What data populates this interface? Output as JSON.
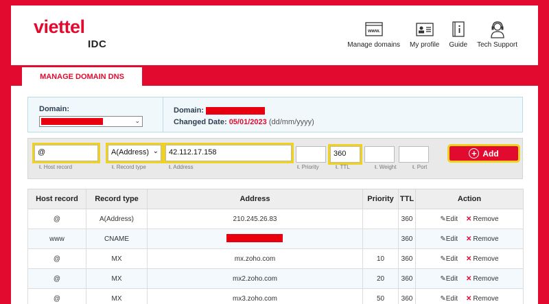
{
  "brand": {
    "name": "viettel",
    "sub": "IDC"
  },
  "nav": [
    {
      "label": "Manage domains",
      "icon": "www-icon",
      "glyph": "www."
    },
    {
      "label": "My profile",
      "icon": "profile-card-icon"
    },
    {
      "label": "Guide",
      "icon": "guide-book-icon"
    },
    {
      "label": "Tech Support",
      "icon": "headset-icon"
    }
  ],
  "tab": {
    "label": "MANAGE DOMAIN DNS"
  },
  "domain": {
    "label": "Domain:",
    "right_label": "Domain:",
    "changed_label": "Changed Date:",
    "changed_date": "05/01/2023",
    "date_format": "(dd/mm/yyyy)"
  },
  "form": {
    "host": {
      "value": "@",
      "label": "Host record"
    },
    "type": {
      "value": "A(Address)",
      "label": "Record type"
    },
    "address": {
      "value": "42.112.17.158",
      "label": "Address"
    },
    "priority": {
      "value": "",
      "label": "Priority"
    },
    "ttl": {
      "value": "360",
      "label": "TTL"
    },
    "weight": {
      "value": "",
      "label": "Weight"
    },
    "port": {
      "value": "",
      "label": "Port"
    },
    "label_prefix": "ŧ.",
    "add_label": "Add"
  },
  "table": {
    "headers": [
      "Host record",
      "Record type",
      "Address",
      "Priority",
      "TTL",
      "Action"
    ],
    "edit_label": "Edit",
    "remove_label": "Remove",
    "rows": [
      {
        "host": "@",
        "type": "A(Address)",
        "address": "210.245.26.83",
        "priority": "",
        "ttl": "360"
      },
      {
        "host": "www",
        "type": "CNAME",
        "address": "",
        "priority": "",
        "ttl": "360"
      },
      {
        "host": "@",
        "type": "MX",
        "address": "mx.zoho.com",
        "priority": "10",
        "ttl": "360"
      },
      {
        "host": "@",
        "type": "MX",
        "address": "mx2.zoho.com",
        "priority": "20",
        "ttl": "360"
      },
      {
        "host": "@",
        "type": "MX",
        "address": "mx3.zoho.com",
        "priority": "50",
        "ttl": "360"
      }
    ]
  },
  "colors": {
    "brand_red": "#e30a2f",
    "highlight": "#f0d21c"
  }
}
